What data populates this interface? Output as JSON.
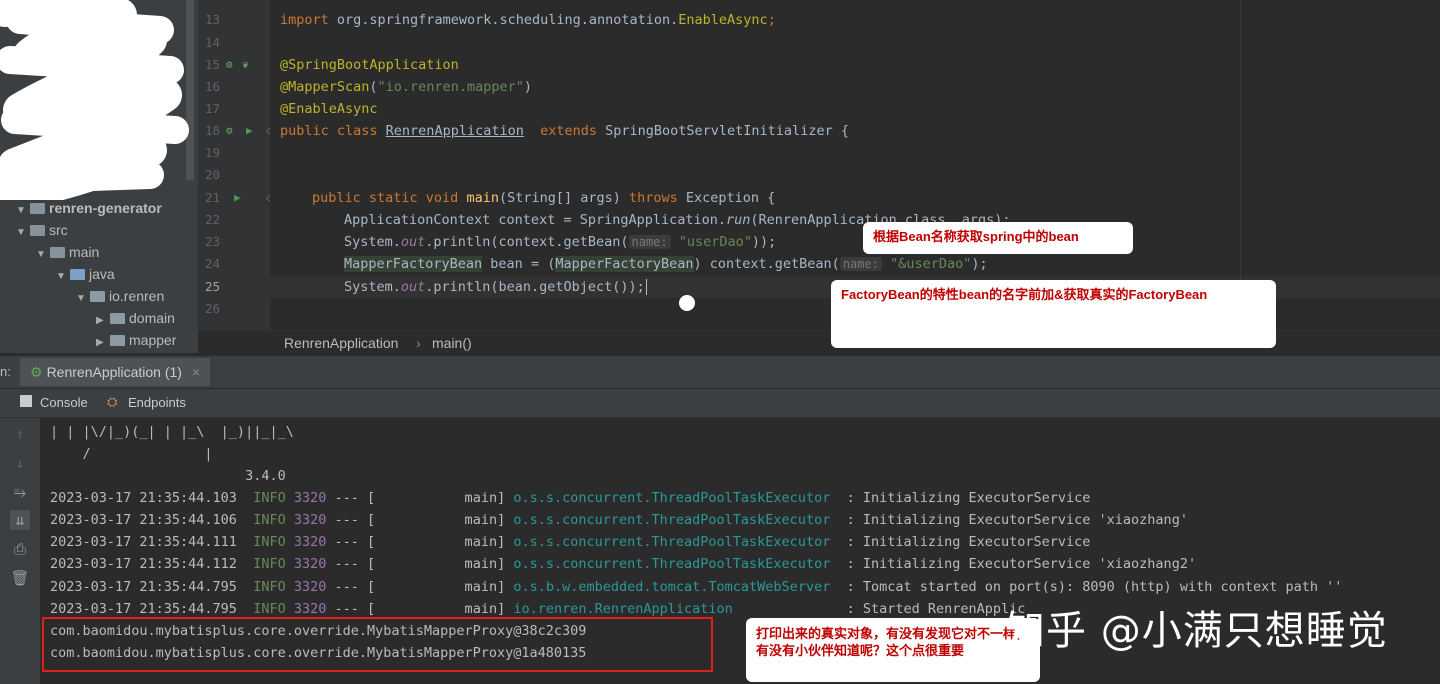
{
  "project_tree": {
    "items": [
      {
        "label": "renren-generator",
        "arrow": "▼",
        "kind": "module"
      },
      {
        "label": "src",
        "arrow": "▼",
        "kind": "folder"
      },
      {
        "label": "main",
        "arrow": "▼",
        "kind": "folder"
      },
      {
        "label": "java",
        "arrow": "▼",
        "kind": "source"
      },
      {
        "label": "io.renren",
        "arrow": "▼",
        "kind": "package"
      },
      {
        "label": "domain",
        "arrow": "▶",
        "kind": "package"
      },
      {
        "label": "mapper",
        "arrow": "▶",
        "kind": "package"
      }
    ]
  },
  "editor": {
    "line_numbers": [
      "13",
      "14",
      "15",
      "16",
      "17",
      "18",
      "19",
      "20",
      "21",
      "22",
      "23",
      "24",
      "25",
      "26"
    ],
    "line1_import_prefix": "import ",
    "line1_import_pkg": "org.springframework.scheduling.annotation.",
    "line1_import_class": "EnableAsync",
    "line1_semicolon": ";",
    "ann_springboot": "@SpringBootApplication",
    "ann_mapperscan": "@MapperScan",
    "mapperscan_arg": "\"io.renren.mapper\"",
    "ann_enableasync": "@EnableAsync",
    "class_decl_kw": "public class ",
    "class_name": "RenrenApplication",
    "class_extends_kw": "  extends ",
    "class_super": "SpringBootServletInitializer {",
    "main_kw": "public static void ",
    "main_name": "main",
    "main_params": "(String[] args) ",
    "main_throws": "throws ",
    "main_exc": "Exception {",
    "line22": "ApplicationContext context = SpringApplication.",
    "line22_run": "run",
    "line22_tail": "(RenrenApplication.class, args);",
    "line23_a": "System.",
    "line23_out": "out",
    "line23_b": ".println(context.getBean(",
    "hint_name": "name:",
    "line23_str": "\"userDao\"",
    "line23_c": "));",
    "line24_type": "MapperFactoryBean",
    "line24_b": " bean = (",
    "line24_cast": "MapperFactoryBean",
    "line24_c": ") context.getBean(",
    "line24_str": "\"&userDao\"",
    "line24_d": ");",
    "line25_a": "System.",
    "line25_out": "out",
    "line25_b": ".println(bean.getObject());",
    "breadcrumb_class": "RenrenApplication",
    "breadcrumb_sep": "›",
    "breadcrumb_method": "main()"
  },
  "run_panel": {
    "label_prefix": "n:",
    "run_tab": "RenrenApplication (1)",
    "close": "×",
    "subtab_console": "Console",
    "subtab_endpoints": "Endpoints"
  },
  "console": {
    "banner1": "| | |\\/|_)(_| | |_\\  |_)||_|_\\",
    "banner2": "    /              |",
    "banner3": "                        3.4.0",
    "logs": [
      {
        "ts": "2023-03-17 21:35:44.103",
        "level": "INFO",
        "pid": "3320",
        "sep": "--- [",
        "thread": "           main]",
        "logger": "o.s.s.concurrent.ThreadPoolTaskExecutor ",
        "msg": " : Initializing ExecutorService"
      },
      {
        "ts": "2023-03-17 21:35:44.106",
        "level": "INFO",
        "pid": "3320",
        "sep": "--- [",
        "thread": "           main]",
        "logger": "o.s.s.concurrent.ThreadPoolTaskExecutor ",
        "msg": " : Initializing ExecutorService 'xiaozhang'"
      },
      {
        "ts": "2023-03-17 21:35:44.111",
        "level": "INFO",
        "pid": "3320",
        "sep": "--- [",
        "thread": "           main]",
        "logger": "o.s.s.concurrent.ThreadPoolTaskExecutor ",
        "msg": " : Initializing ExecutorService"
      },
      {
        "ts": "2023-03-17 21:35:44.112",
        "level": "INFO",
        "pid": "3320",
        "sep": "--- [",
        "thread": "           main]",
        "logger": "o.s.s.concurrent.ThreadPoolTaskExecutor ",
        "msg": " : Initializing ExecutorService 'xiaozhang2'"
      },
      {
        "ts": "2023-03-17 21:35:44.795",
        "level": "INFO",
        "pid": "3320",
        "sep": "--- [",
        "thread": "           main]",
        "logger": "o.s.b.w.embedded.tomcat.TomcatWebServer ",
        "msg": " : Tomcat started on port(s): 8090 (http) with context path ''"
      },
      {
        "ts": "2023-03-17 21:35:44.795",
        "level": "INFO",
        "pid": "3320",
        "sep": "--- [",
        "thread": "           main]",
        "logger": "io.renren.RenrenApplication             ",
        "msg": " : Started RenrenApplic"
      }
    ],
    "output1": "com.baomidou.mybatisplus.core.override.MybatisMapperProxy@38c2c309",
    "output2": "com.baomidou.mybatisplus.core.override.MybatisMapperProxy@1a480135"
  },
  "annotations": {
    "note1": "根据Bean名称获取spring中的bean",
    "note2": "FactoryBean的特性bean的名字前加&获取真实的FactoryBean",
    "note3": "打印出来的真实对象，有没有发现它对不一样，有没有小伙伴知道呢？这个点很重要"
  },
  "watermark": "知乎 @小满只想睡觉"
}
